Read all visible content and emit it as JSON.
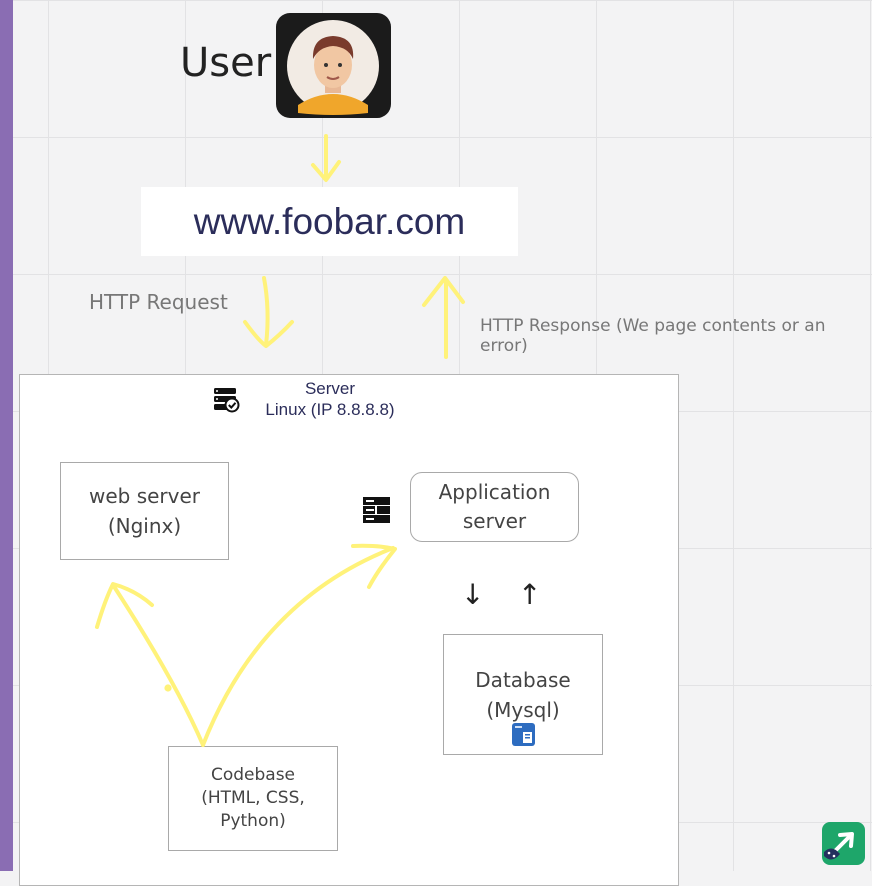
{
  "user": {
    "label": "User"
  },
  "site": {
    "url": "www.foobar.com"
  },
  "labels": {
    "http_request": "HTTP Request",
    "http_response": "HTTP Response (We page contents or an error)"
  },
  "server": {
    "title_line1": "Server",
    "title_line2": "Linux (IP 8.8.8.8)"
  },
  "components": {
    "web_server": {
      "line1": "web server",
      "line2": "(Nginx)"
    },
    "app_server": {
      "line1": "Application",
      "line2": "server"
    },
    "database": {
      "line1": "Database",
      "line2": "(Mysql)"
    },
    "codebase": {
      "line1": "Codebase",
      "line2": "(HTML, CSS,",
      "line3": "Python)"
    }
  },
  "arrows": {
    "down": "↓",
    "up": "↑"
  },
  "colors": {
    "annotation_yellow": "#fff27a",
    "left_strip": "#8a6db3",
    "url_text": "#2b2d5a",
    "badge_green": "#1ea66a"
  },
  "icons": [
    "user-avatar-icon",
    "server-status-icon",
    "server-rack-icon",
    "mysql-db-icon",
    "corner-app-icon"
  ]
}
